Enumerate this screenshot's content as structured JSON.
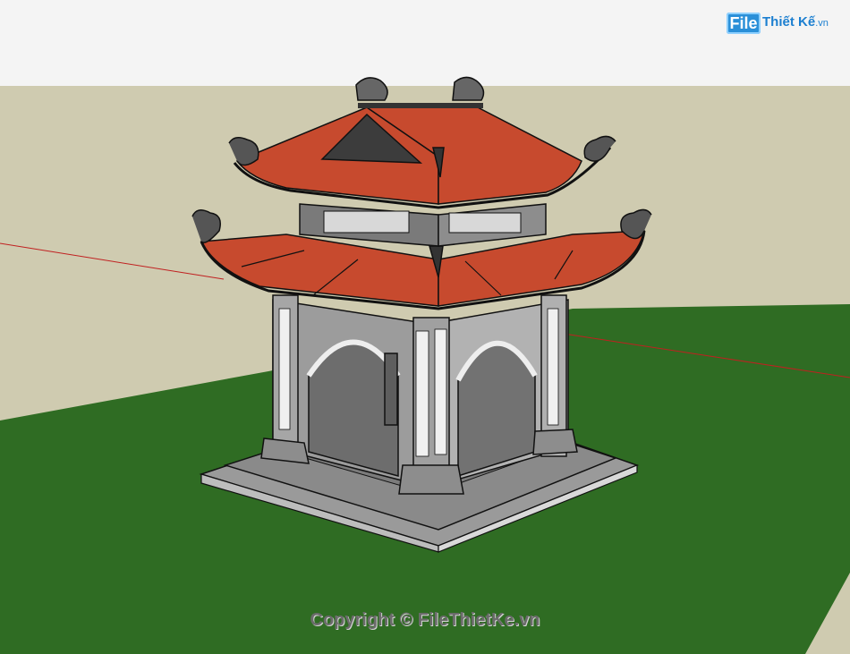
{
  "watermark": {
    "logo_badge": "File",
    "logo_name": "Thiết Kế",
    "logo_tld": ".vn",
    "copyright": "Copyright © FileThietKe.vn"
  },
  "scene": {
    "colors": {
      "sky": "#f4f4f4",
      "ground": "#cfcbb0",
      "grass": "#2f6c23",
      "roof": "#c74a2e",
      "stone": "#8a8a8a",
      "stone_light": "#c8c8c8",
      "outline": "#111111",
      "axis": "#c02020"
    }
  }
}
